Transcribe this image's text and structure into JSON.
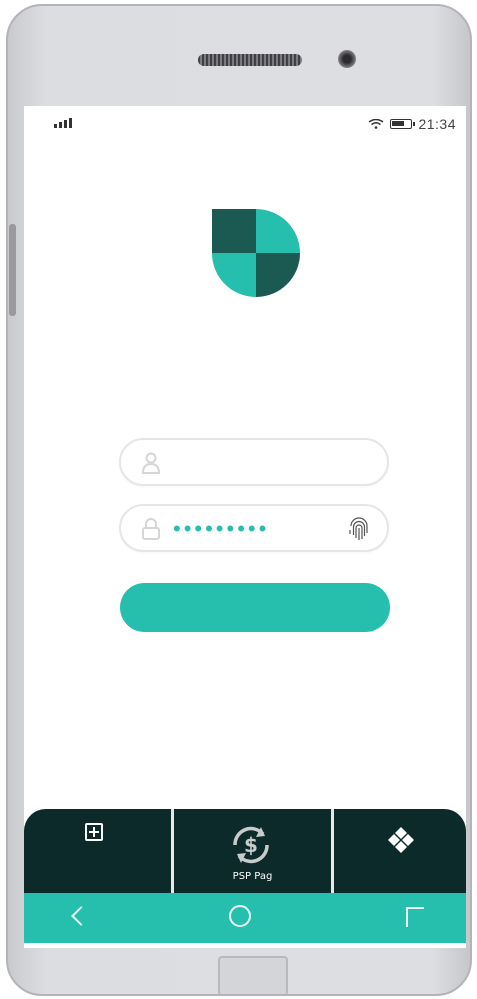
{
  "status_bar": {
    "time": "21:34",
    "signal_icon": "signal-bars-icon",
    "wifi_icon": "wifi-icon",
    "battery_icon": "battery-icon"
  },
  "login": {
    "username": {
      "value": "",
      "icon": "user-icon"
    },
    "password": {
      "masked_value": "•••••••••",
      "icon": "lock-icon",
      "biometric_icon": "fingerprint-icon"
    },
    "submit_label": ""
  },
  "tabs": [
    {
      "icon": "add-box-icon",
      "label": ""
    },
    {
      "icon": "cash-cycle-icon",
      "label": "PSP Pag"
    },
    {
      "icon": "diamond-pattern-icon",
      "label": ""
    }
  ],
  "navigation": {
    "back_icon": "back-icon",
    "home_icon": "home-icon",
    "recents_icon": "recents-icon"
  },
  "colors": {
    "accent": "#26bfae",
    "dark_teal": "#0d2a2a",
    "logo_dark": "#1a5a52"
  }
}
